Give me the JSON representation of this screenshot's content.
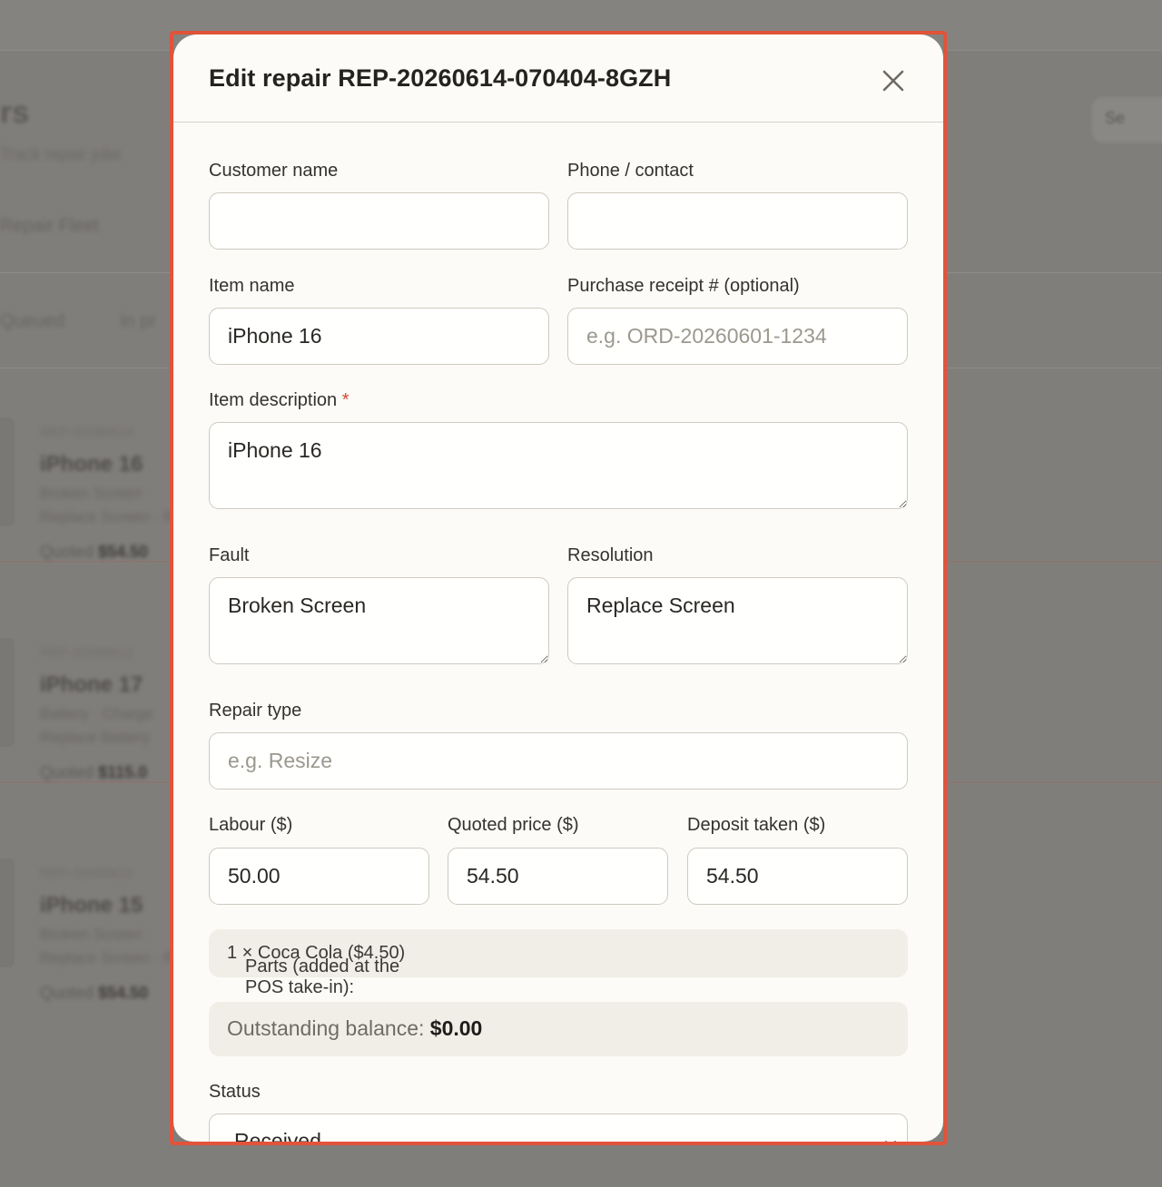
{
  "background": {
    "heading": "rs",
    "subtitle": "Track repair jobs",
    "tab": "Repair Fleet",
    "filters": [
      "Queued",
      "In pr"
    ],
    "cards": [
      {
        "ref": "REP-20260614",
        "title": "iPhone 16",
        "line1": "Broken Screen",
        "line2": "Replace Screen · Rec",
        "quote_label": "Quoted",
        "quote_value": "$54.50"
      },
      {
        "ref": "REP-20260612",
        "title": "iPhone 17",
        "line1": "Battery · Charge",
        "line2": "Replace Battery",
        "quote_label": "Quoted",
        "quote_value": "$115.0"
      },
      {
        "ref": "REP-20260610",
        "title": "iPhone 15",
        "line1": "Broken Screen",
        "line2": "Replace Screen · R",
        "quote_label": "Quoted",
        "quote_value": "$54.50"
      }
    ],
    "right_button": "Se"
  },
  "modal": {
    "title": "Edit repair REP-20260614-070404-8GZH",
    "close_icon": "close-icon",
    "fields": {
      "customer_name": {
        "label": "Customer name",
        "value": "",
        "placeholder": ""
      },
      "phone": {
        "label": "Phone / contact",
        "value": "",
        "placeholder": ""
      },
      "item_name": {
        "label": "Item name",
        "value": "iPhone 16"
      },
      "receipt": {
        "label": "Purchase receipt # (optional)",
        "value": "",
        "placeholder": "e.g. ORD-20260601-1234"
      },
      "item_description": {
        "label": "Item description",
        "required_mark": "*",
        "value": "iPhone 16"
      },
      "fault": {
        "label": "Fault",
        "value": "Broken Screen"
      },
      "resolution": {
        "label": "Resolution",
        "value": "Replace Screen"
      },
      "repair_type": {
        "label": "Repair type",
        "value": "",
        "placeholder": "e.g. Resize"
      },
      "labour": {
        "label": "Labour ($)",
        "value": "50.00"
      },
      "quoted_price": {
        "label": "Quoted price ($)",
        "value": "54.50"
      },
      "deposit": {
        "label": "Deposit taken ($)",
        "value": "54.50"
      }
    },
    "parts": {
      "label": "Parts (added at the POS take-in):",
      "value": "1 × Coca Cola ($4.50)"
    },
    "balance": {
      "label": "Outstanding balance:",
      "value": "$0.00"
    },
    "status": {
      "label": "Status",
      "value": "Received",
      "icon": "chevron-down-icon"
    }
  },
  "colors": {
    "accent_outline": "#e2533a",
    "required": "#d24a35",
    "modal_bg": "#fcfbf7",
    "info_bg": "#f1eee7"
  }
}
